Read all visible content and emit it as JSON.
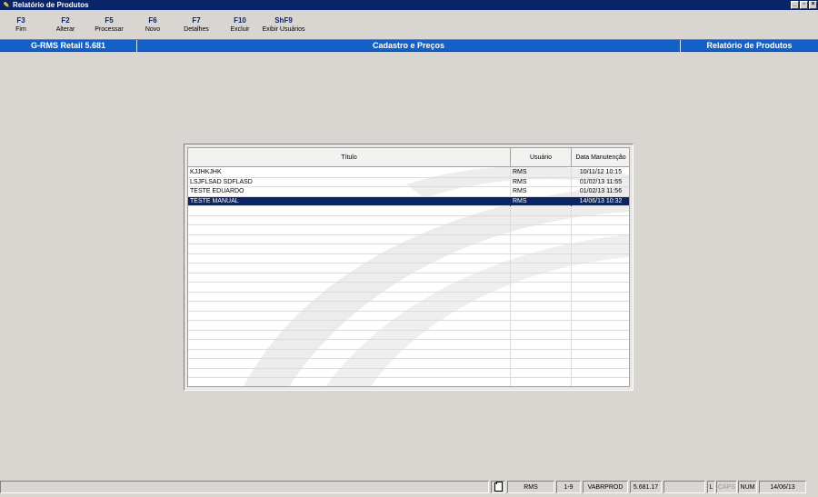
{
  "window": {
    "title": "Relatório de Produtos"
  },
  "toolbar": [
    {
      "key": "F3",
      "label": "Fim"
    },
    {
      "key": "F2",
      "label": "Alterar"
    },
    {
      "key": "F5",
      "label": "Processar"
    },
    {
      "key": "F6",
      "label": "Novo"
    },
    {
      "key": "F7",
      "label": "Detalhes"
    },
    {
      "key": "F10",
      "label": "Excluir"
    },
    {
      "key": "ShF9",
      "label": "Exibir Usuários"
    }
  ],
  "header": {
    "system": "G-RMS Retail 5.681",
    "module": "Cadastro e Preços",
    "screen": "Relatório de Produtos"
  },
  "grid": {
    "columns": [
      "Título",
      "Usuário",
      "Data Manutenção"
    ],
    "rows": [
      {
        "titulo": "KJJHKJHK",
        "usuario": "RMS",
        "data": "10/11/12 10:15"
      },
      {
        "titulo": "LSJFLSAD SDFLASD",
        "usuario": "RMS",
        "data": "01/02/13 11:55"
      },
      {
        "titulo": "TESTE EDUARDO",
        "usuario": "RMS",
        "data": "01/02/13 11:56"
      },
      {
        "titulo": "TESTE MANUAL",
        "usuario": "RMS",
        "data": "14/06/13 10:32"
      }
    ],
    "selected_index": 3
  },
  "statusbar": {
    "user": "RMS",
    "page": "1-9",
    "program": "VABRPROD",
    "version": "5.681.17",
    "l_flag": "L",
    "caps": "CAPS",
    "num": "NUM",
    "date": "14/06/13"
  },
  "colors": {
    "titlebar": "#0a246a",
    "header": "#1560c8",
    "selection": "#0a246a",
    "background": "#d9d5d1"
  }
}
